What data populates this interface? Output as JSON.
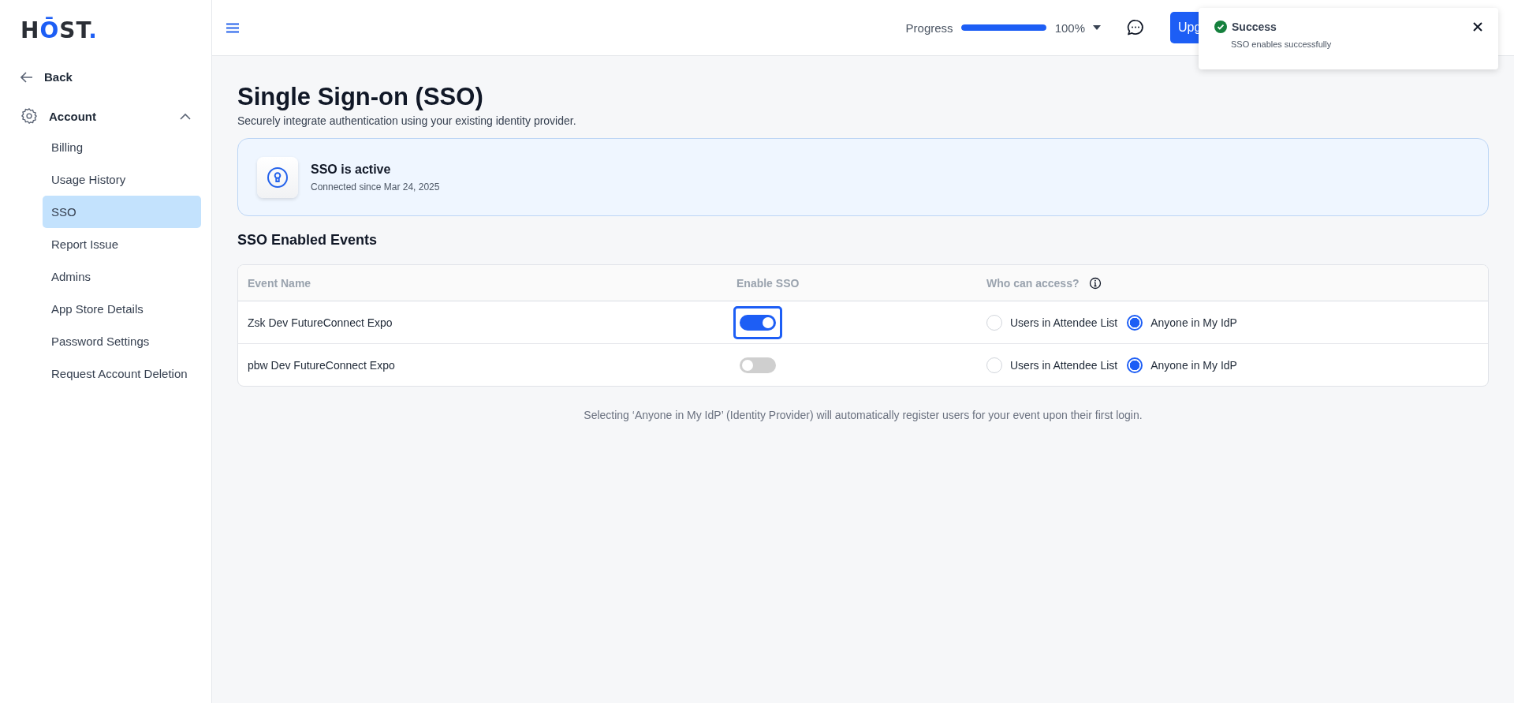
{
  "logo": [
    {
      "text": "H",
      "accent": false
    },
    {
      "text": "Ō",
      "accent": true
    },
    {
      "text": "ST",
      "accent": false
    },
    {
      "text": ".",
      "accent": true
    }
  ],
  "sidebar": {
    "back": "Back",
    "section": {
      "label": "Account",
      "expanded": true,
      "items": [
        {
          "label": "Billing",
          "selected": false
        },
        {
          "label": "Usage History",
          "selected": false
        },
        {
          "label": "SSO",
          "selected": true
        },
        {
          "label": "Report Issue",
          "selected": false
        },
        {
          "label": "Admins",
          "selected": false
        },
        {
          "label": "App Store Details",
          "selected": false
        },
        {
          "label": "Password Settings",
          "selected": false
        },
        {
          "label": "Request Account Deletion",
          "selected": false
        }
      ]
    }
  },
  "header": {
    "progress_label": "Progress",
    "progress": {
      "level": 1.0
    },
    "progress_value": "100%",
    "upgrade_button": "Upg"
  },
  "toast": {
    "title": "Success",
    "message": "SSO enables successfully"
  },
  "page": {
    "title": "Single Sign-on (SSO)",
    "subtitle": "Securely integrate authentication using your existing identity provider.",
    "status": {
      "title": "SSO is active",
      "detail": "Connected since Mar 24, 2025"
    },
    "section_title": "SSO Enabled Events",
    "table": {
      "columns": [
        "Event Name",
        "Enable SSO",
        "Who can access?"
      ],
      "rows": [
        {
          "name": "Zsk Dev FutureConnect Expo",
          "enabled": true,
          "focused": true,
          "options": [
            {
              "label": "Users in Attendee List",
              "selected": false
            },
            {
              "label": "Anyone in My IdP",
              "selected": true
            }
          ]
        },
        {
          "name": "pbw Dev FutureConnect Expo",
          "enabled": false,
          "focused": false,
          "options": [
            {
              "label": "Users in Attendee List",
              "selected": false
            },
            {
              "label": "Anyone in My IdP",
              "selected": true
            }
          ]
        }
      ]
    },
    "footnote": "Selecting ‘Anyone in My IdP’ (Identity Provider) will automatically register users for your event upon their first login."
  }
}
